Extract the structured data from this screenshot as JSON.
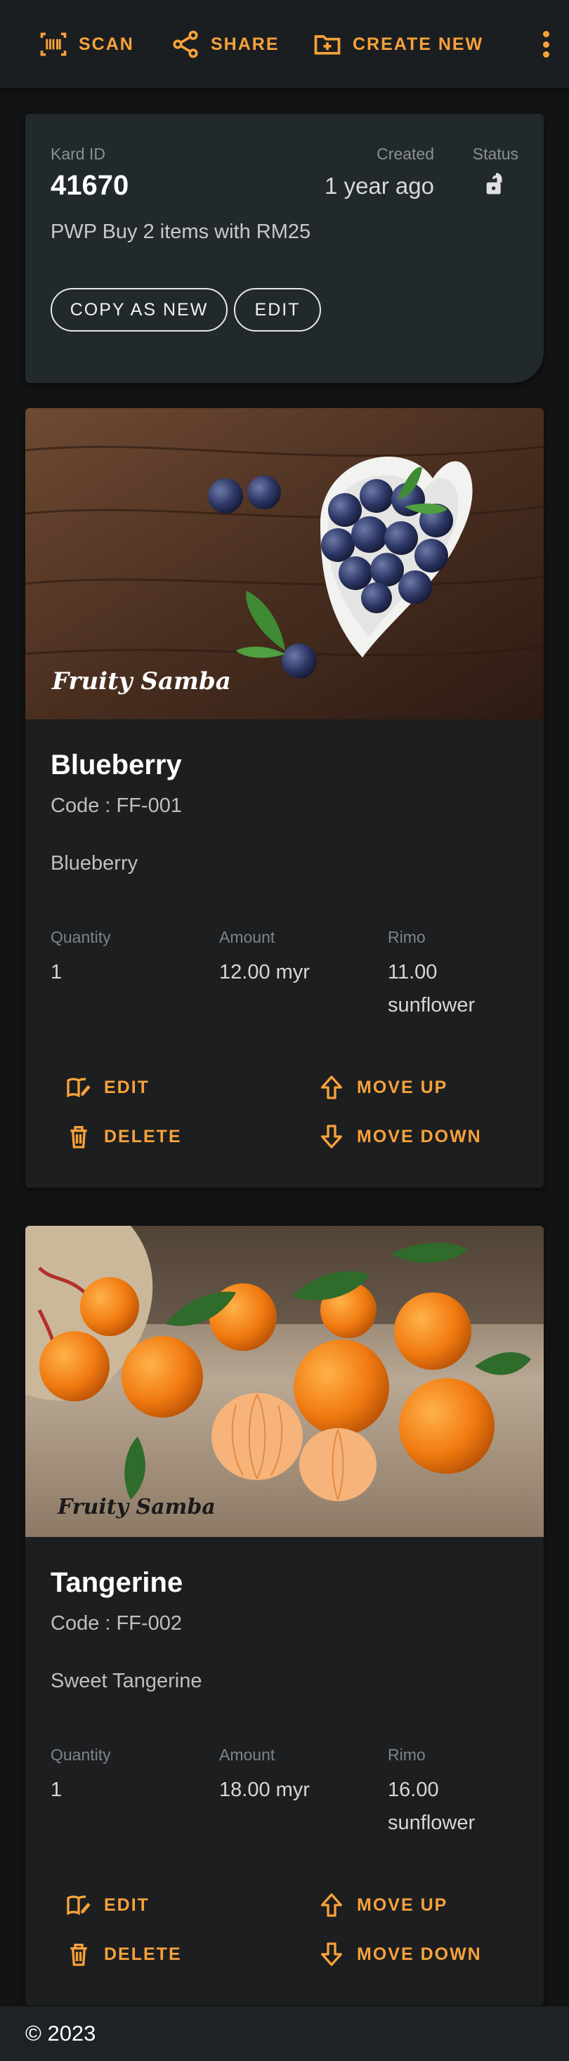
{
  "toolbar": {
    "scan_label": "SCAN",
    "share_label": "SHARE",
    "create_label": "CREATE NEW",
    "accent": "#f7a23a"
  },
  "kard": {
    "id_label": "Kard ID",
    "id_value": "41670",
    "created_label": "Created",
    "created_value": "1 year ago",
    "status_label": "Status",
    "status_icon": "unlock-icon",
    "description": "PWP Buy 2 items with RM25",
    "copy_label": "COPY AS NEW",
    "edit_label": "EDIT"
  },
  "items": [
    {
      "image_logo": "Fruity Samba",
      "title": "Blueberry",
      "code": "Code : FF-001",
      "description": "Blueberry",
      "quantity_label": "Quantity",
      "quantity": "1",
      "amount_label": "Amount",
      "amount": "12.00 myr",
      "rimo_label": "Rimo",
      "rimo": "11.00 sunflower",
      "edit_label": "EDIT",
      "delete_label": "DELETE",
      "up_label": "MOVE UP",
      "down_label": "MOVE DOWN"
    },
    {
      "image_logo": "Fruity Samba",
      "title": "Tangerine",
      "code": "Code : FF-002",
      "description": "Sweet Tangerine",
      "quantity_label": "Quantity",
      "quantity": "1",
      "amount_label": "Amount",
      "amount": "18.00 myr",
      "rimo_label": "Rimo",
      "rimo": "16.00 sunflower",
      "edit_label": "EDIT",
      "delete_label": "DELETE",
      "up_label": "MOVE UP",
      "down_label": "MOVE DOWN"
    }
  ],
  "footer": {
    "copyright": "© 2023"
  }
}
